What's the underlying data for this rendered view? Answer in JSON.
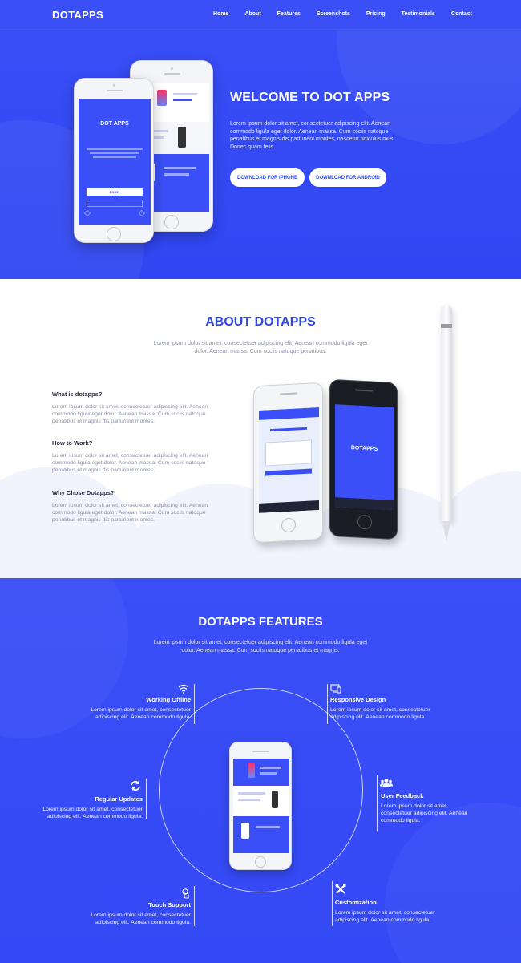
{
  "navbar": {
    "brand": "DOTAPPS",
    "links": [
      "Home",
      "About",
      "Features",
      "Screenshots",
      "Pricing",
      "Testimonials",
      "Contact"
    ]
  },
  "hero": {
    "title": "WELCOME TO DOT APPS",
    "text": "Lorem ipsum dolor sit amet, consectetuer adipiscing elit. Aenean commodo ligula eget dolor. Aenean massa. Cum sociis natoque penatibus et magnis dis parturient montes, nascetur ridiculus mus. Donec quam felis.",
    "btn_iphone": "DOWNLOAD FOR IPHONE",
    "btn_android": "DOWNLOAD FOR ANDROID",
    "phone_app_title": "DOT APPS",
    "phone_login": "LOGIN"
  },
  "about": {
    "title": "ABOUT DOTAPPS",
    "subtitle": "Lorem ipsum dolor sit amet, consectetuer adipiscing elit. Aenean commodo ligula eget dolor. Aenean massa. Cum sociis natoque penatibus.",
    "items": [
      {
        "title": "What is dotapps?",
        "text": "Lorem ipsum dolor sit amet, consectetuer adipiscing elit. Aenean commodo ligula eget dolor. Aenean massa. Cum sociis natoque penatibus et magnis dis parturient montes."
      },
      {
        "title": "How to Work?",
        "text": "Lorem ipsum dolor sit amet, consectetuer adipiscing elit. Aenean commodo ligula eget dolor. Aenean massa. Cum sociis natoque penatibus et magnis dis parturient montes."
      },
      {
        "title": "Why Chose Dotapps?",
        "text": "Lorem ipsum dolor sit amet, consectetuer adipiscing elit. Aenean commodo ligula eget dolor. Aenean massa. Cum sociis natoque penatibus et magnis dis parturient montes."
      }
    ],
    "phone_brand": "DOTAPPS"
  },
  "features": {
    "title": "DOTAPPS FEATURES",
    "subtitle": "Lorem ipsum dolor sit amet, consectetuer adipiscing elit. Aenean commodo ligula eget dolor. Aenean massa. Cum sociis natoque penatibus et magnis.",
    "items": [
      {
        "name": "Working Offline",
        "text": "Lorem ipsum dolor sit amet, consectetuer adipiscing elit. Aenean commodo ligula.",
        "icon": "wifi-icon"
      },
      {
        "name": "Regular Updates",
        "text": "Lorem ipsum dolor sit amet, consectetuer adipiscing elit. Aenean commodo ligula.",
        "icon": "refresh-icon"
      },
      {
        "name": "Touch Support",
        "text": "Lorem ipsum dolor sit amet, consectetuer adipiscing elit. Aenean commodo ligula.",
        "icon": "touch-icon"
      },
      {
        "name": "Responsive Design",
        "text": "Lorem ipsum dolor sit amet, consectetuer adipiscing elit. Aenean commodo ligula.",
        "icon": "devices-icon"
      },
      {
        "name": "User Feedback",
        "text": "Lorem ipsum dolor sit amet, consectetuer adipiscing elit. Aenean commodo ligula.",
        "icon": "users-icon"
      },
      {
        "name": "Customization",
        "text": "Lorem ipsum dolor sit amet, consectetuer adipiscing elit. Aenean commodo ligula.",
        "icon": "tools-icon"
      }
    ]
  },
  "colors": {
    "primary": "#3a4ff7",
    "white": "#ffffff",
    "heading_blue": "#2f45e8",
    "body_grey": "#8b90a6"
  }
}
